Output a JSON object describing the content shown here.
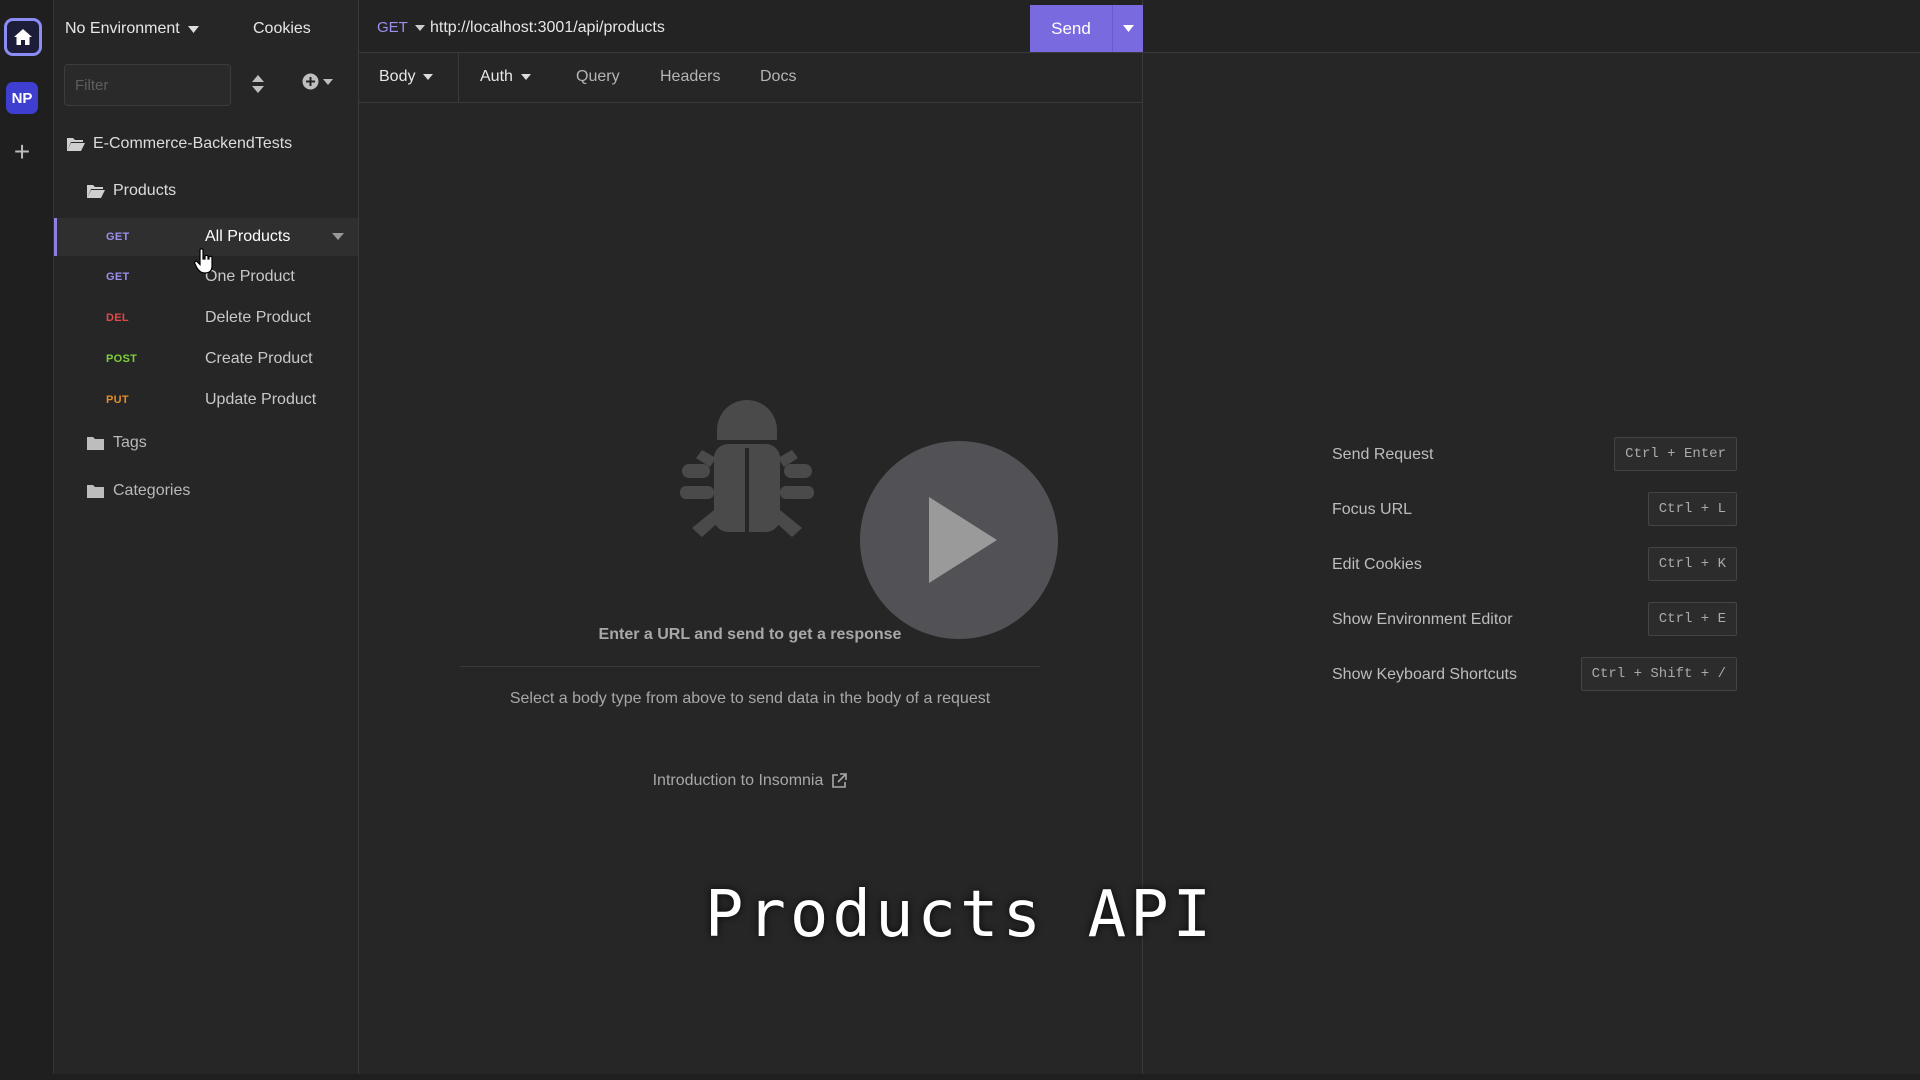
{
  "sidebar": {
    "environment": "No Environment",
    "cookies_label": "Cookies",
    "filter_placeholder": "Filter",
    "workspace": "E-Commerce-BackendTests",
    "folders": {
      "products": "Products",
      "tags": "Tags",
      "categories": "Categories"
    },
    "requests": [
      {
        "method": "GET",
        "label": "All Products",
        "selected": true
      },
      {
        "method": "GET",
        "label": "One Product"
      },
      {
        "method": "DEL",
        "label": "Delete Product"
      },
      {
        "method": "POST",
        "label": "Create Product"
      },
      {
        "method": "PUT",
        "label": "Update Product"
      }
    ]
  },
  "rail": {
    "home_icon": "home-icon",
    "project_badge": "NP",
    "add_icon": "+"
  },
  "request": {
    "method": "GET",
    "url": "http://localhost:3001/api/products",
    "send_label": "Send",
    "tabs": {
      "body": "Body",
      "auth": "Auth",
      "query": "Query",
      "headers": "Headers",
      "docs": "Docs"
    },
    "empty_title": "Enter a URL and send to get a response",
    "empty_desc": "Select a body type from above to send data in the body of a request",
    "intro_link": "Introduction to Insomnia"
  },
  "shortcuts": [
    {
      "label": "Send Request",
      "keys": "Ctrl + Enter"
    },
    {
      "label": "Focus URL",
      "keys": "Ctrl + L"
    },
    {
      "label": "Edit Cookies",
      "keys": "Ctrl + K"
    },
    {
      "label": "Show Environment Editor",
      "keys": "Ctrl + E"
    },
    {
      "label": "Show Keyboard Shortcuts",
      "keys": "Ctrl + Shift + /"
    }
  ],
  "overlay": {
    "caption": "Products API"
  },
  "colors": {
    "accent": "#7a6adf",
    "get": "#9b90f0",
    "del": "#e24a4a",
    "post": "#7ccf3a",
    "put": "#e08d2c"
  }
}
